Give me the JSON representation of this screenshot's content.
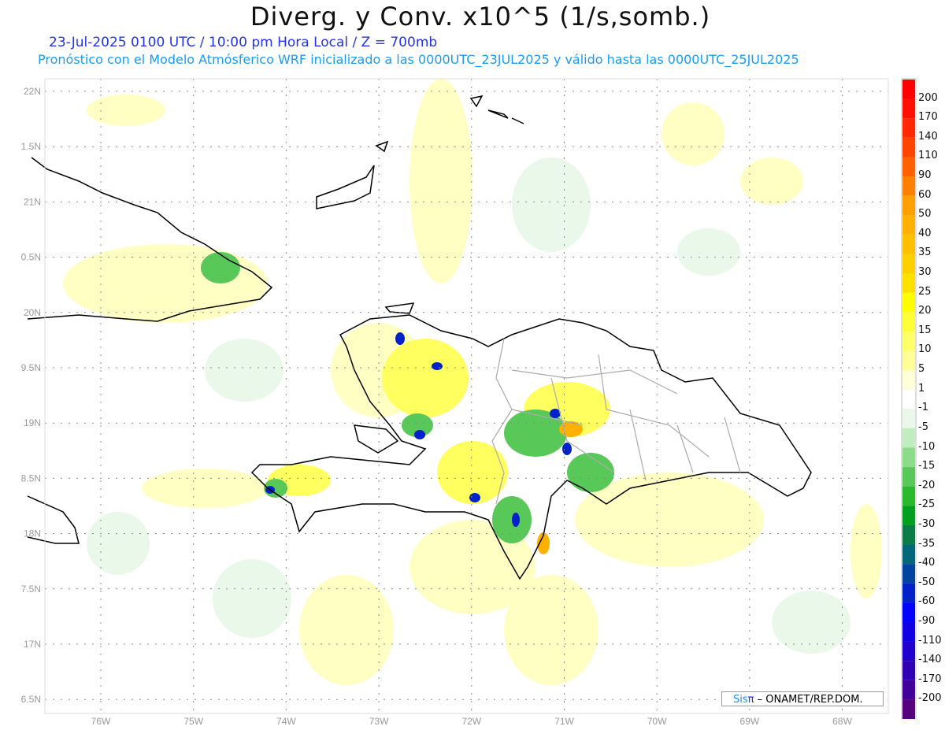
{
  "title": "Diverg. y Conv. x10^5 (1/s,somb.)",
  "subtitle1": "23-Jul-2025  0100 UTC / 10:00 pm Hora Local / Z = 700mb",
  "subtitle2": "Pronóstico con el Modelo Atmósferico WRF inicializado a las 0000UTC_23JUL2025 y válido hasta las  0000UTC_25JUL2025",
  "lat_labels": [
    "22N",
    "1.5N",
    "21N",
    "0.5N",
    "20N",
    "9.5N",
    "19N",
    "8.5N",
    "18N",
    "7.5N",
    "17N",
    "6.5N"
  ],
  "lon_labels": [
    "76W",
    "75W",
    "74W",
    "73W",
    "72W",
    "71W",
    "70W",
    "69W",
    "68W"
  ],
  "colorbar": {
    "labels": [
      "200",
      "170",
      "140",
      "110",
      "90",
      "60",
      "50",
      "40",
      "35",
      "30",
      "25",
      "20",
      "15",
      "10",
      "5",
      "1",
      "-1",
      "-5",
      "-10",
      "-15",
      "-20",
      "-25",
      "-30",
      "-35",
      "-40",
      "-50",
      "-60",
      "-90",
      "-110",
      "-140",
      "-170",
      "-200"
    ],
    "colors": [
      "#ff0000",
      "#ff1000",
      "#ff2800",
      "#ff4400",
      "#ff6000",
      "#ff8000",
      "#ffa000",
      "#ffb000",
      "#ffc000",
      "#ffd000",
      "#ffe000",
      "#ffff00",
      "#ffff38",
      "#ffff68",
      "#ffff98",
      "#ffffd8",
      "#ffffff",
      "#eaf8ea",
      "#c0ecc0",
      "#8cdc8c",
      "#58c858",
      "#2ab82e",
      "#00a020",
      "#0a7c48",
      "#006878",
      "#0044a0",
      "#0022c8",
      "#0000ff",
      "#1000e4",
      "#2000cc",
      "#3000b4",
      "#42009a",
      "#560080"
    ]
  },
  "credit": {
    "brand": "Sis",
    "brand_symbol": "π",
    "text": " – ONAMET/REP.DOM."
  }
}
